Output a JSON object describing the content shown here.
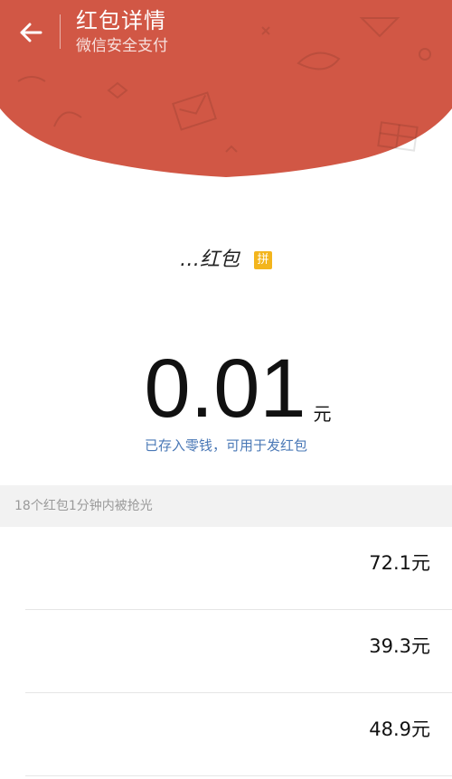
{
  "header": {
    "title": "红包详情",
    "subtitle": "微信安全支付",
    "back_icon": "arrow-left-icon",
    "color": "#d15745"
  },
  "sender": {
    "name": "…红包",
    "badge": "拼",
    "badge_color": "#f3b51d"
  },
  "amount": {
    "value": "0.01",
    "unit": "元",
    "note": "已存入零钱，可用于发红包",
    "note_color": "#4a78b6"
  },
  "summary": {
    "text": "18个红包1分钟内被抢光"
  },
  "list": {
    "items": [
      {
        "value": "72.1元"
      },
      {
        "value": "39.3元"
      },
      {
        "value": "48.9元"
      }
    ]
  }
}
